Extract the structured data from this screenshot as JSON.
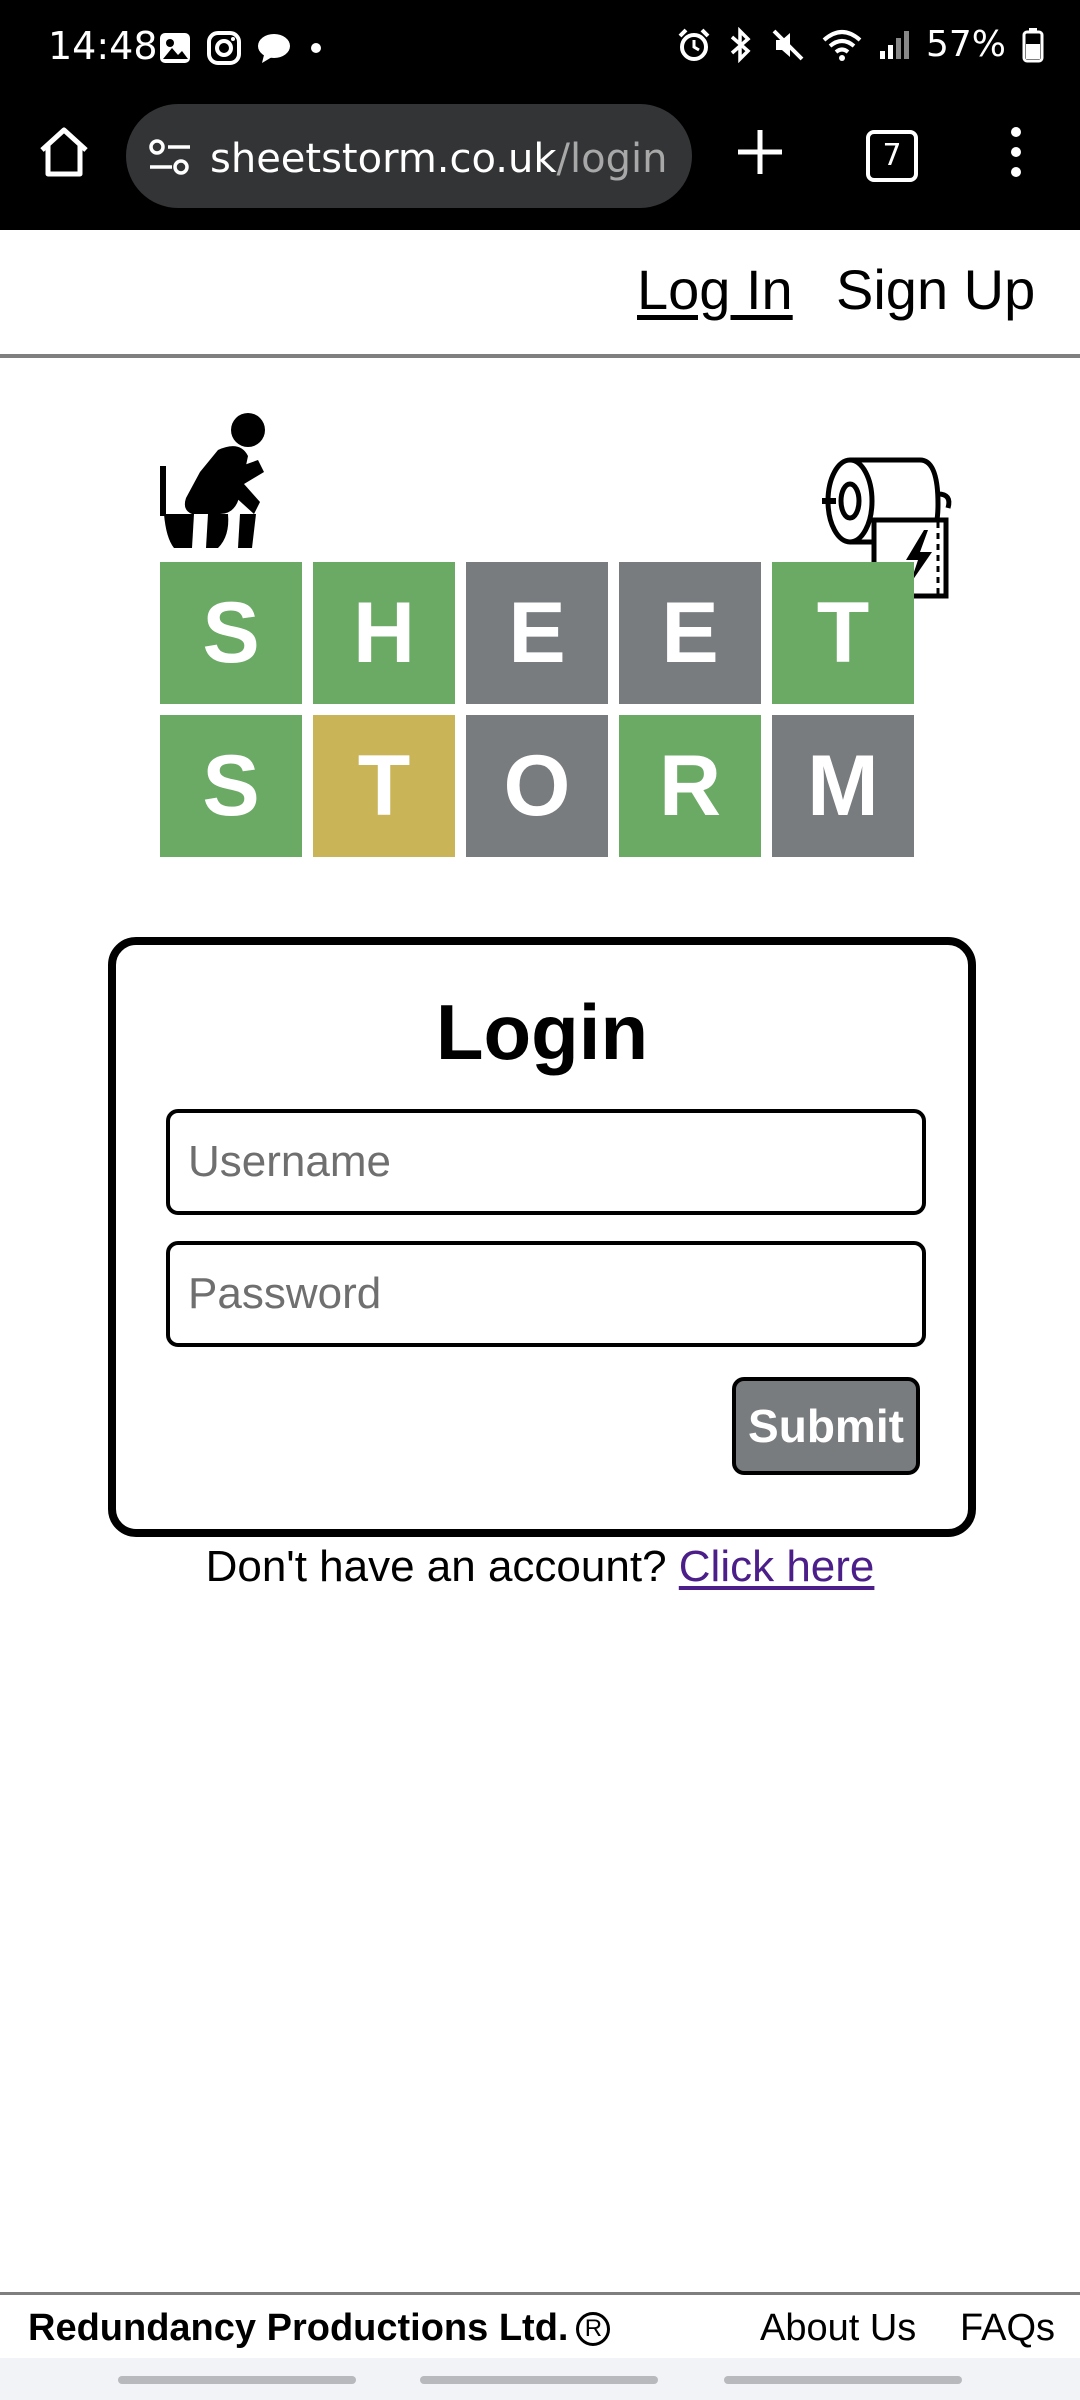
{
  "status_bar": {
    "time": "14:48",
    "battery": "57%",
    "left_icons": [
      "gallery-icon",
      "instagram-icon",
      "chat-icon",
      "dot-icon"
    ],
    "right_icons": [
      "alarm-icon",
      "bluetooth-icon",
      "mute-icon",
      "wifi-icon",
      "signal-icon",
      "battery-icon"
    ]
  },
  "browser": {
    "url_domain": "sheetstorm.co.uk",
    "url_path": "/login",
    "tab_count": "7"
  },
  "nav": {
    "login": "Log In",
    "signup": "Sign Up"
  },
  "logo": {
    "row1": [
      {
        "letter": "S",
        "color": "#6aaa64"
      },
      {
        "letter": "H",
        "color": "#6aaa64"
      },
      {
        "letter": "E",
        "color": "#787c7e"
      },
      {
        "letter": "E",
        "color": "#787c7e"
      },
      {
        "letter": "T",
        "color": "#6aaa64"
      }
    ],
    "row2": [
      {
        "letter": "S",
        "color": "#6aaa64"
      },
      {
        "letter": "T",
        "color": "#c9b458"
      },
      {
        "letter": "O",
        "color": "#787c7e"
      },
      {
        "letter": "R",
        "color": "#6aaa64"
      },
      {
        "letter": "M",
        "color": "#787c7e"
      }
    ]
  },
  "login_form": {
    "title": "Login",
    "username_placeholder": "Username",
    "password_placeholder": "Password",
    "submit_label": "Submit"
  },
  "signup_prompt": {
    "text": "Don't have an account?",
    "link": "Click here"
  },
  "footer": {
    "company": "Redundancy Productions Ltd.",
    "registered_mark": "R",
    "about": "About Us",
    "faqs": "FAQs"
  }
}
